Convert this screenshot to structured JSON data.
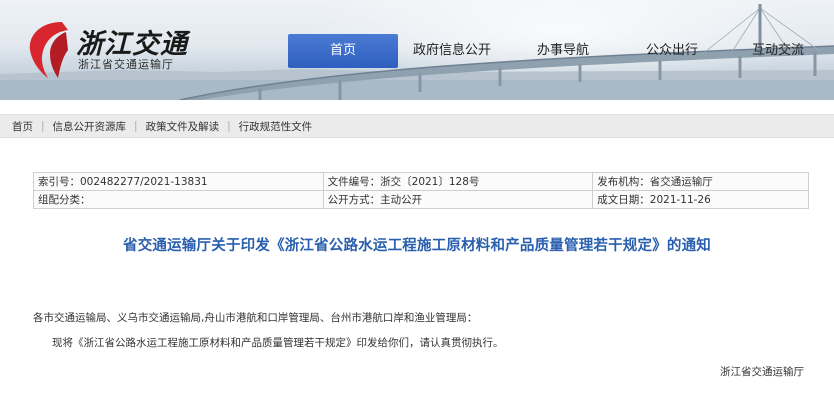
{
  "site": {
    "logo_text": "浙江交通",
    "org_name": "浙江省交通运输厅"
  },
  "nav": {
    "items": [
      {
        "label": "首页",
        "active": true
      },
      {
        "label": "政府信息公开",
        "active": false
      },
      {
        "label": "办事导航",
        "active": false
      },
      {
        "label": "公众出行",
        "active": false
      },
      {
        "label": "互动交流",
        "active": false
      }
    ]
  },
  "breadcrumb": [
    "首页",
    "信息公开资源库",
    "政策文件及解读",
    "行政规范性文件"
  ],
  "meta": {
    "index_no": "索引号：002482277/2021-13831",
    "doc_no": "文件编号：浙交〔2021〕128号",
    "publisher": "发布机构：省交通运输厅",
    "category": "组配分类：",
    "disclosure": "公开方式：主动公开",
    "date": "成文日期：2021-11-26"
  },
  "article": {
    "title": "省交通运输厅关于印发《浙江省公路水运工程施工原材料和产品质量管理若干规定》的通知",
    "recipients": "各市交通运输局、义乌市交通运输局,舟山市港航和口岸管理局、台州市港航口岸和渔业管理局：",
    "body": "现将《浙江省公路水运工程施工原材料和产品质量管理若干规定》印发给你们，请认真贯彻执行。",
    "signature": "浙江省交通运输厅"
  },
  "colors": {
    "nav_active_bg": "#3a6cc8",
    "title_blue": "#2a5fae",
    "logo_red": "#d7262e"
  },
  "icons": {
    "logo": "red-swoosh-logo-icon"
  }
}
